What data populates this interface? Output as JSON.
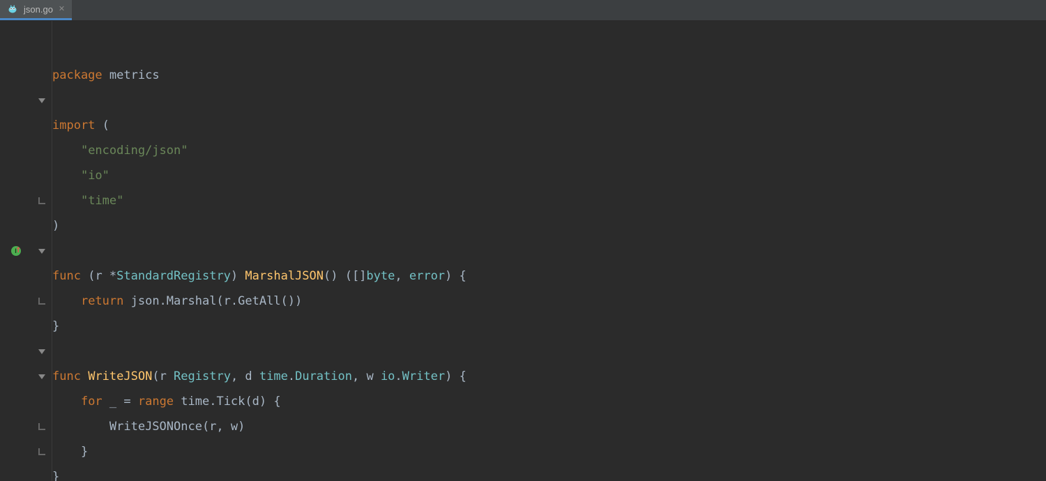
{
  "tab": {
    "filename": "json.go",
    "close_glyph": "✕"
  },
  "gutter_marker": "implements-up",
  "code": {
    "l1": {
      "kw": "package",
      "id": "metrics"
    },
    "l3": {
      "kw": "import",
      "p": "("
    },
    "l4": {
      "s": "\"encoding/json\""
    },
    "l5": {
      "s": "\"io\""
    },
    "l6": {
      "s": "\"time\""
    },
    "l7": {
      "p": ")"
    },
    "l9": {
      "kw": "func",
      "p1": "(r *",
      "t1": "StandardRegistry",
      "p2": ") ",
      "fn": "MarshalJSON",
      "p3": "() ([]",
      "t2": "byte",
      "p4": ", ",
      "t3": "error",
      "p5": ") {"
    },
    "l10": {
      "kw": "return",
      "rest": " json.Marshal(r.GetAll())"
    },
    "l11": {
      "p": "}"
    },
    "l13": {
      "kw": "func",
      "sp": " ",
      "fn": "WriteJSON",
      "p1": "(r ",
      "t1": "Registry",
      "p2": ", d ",
      "t2": "time",
      "p3": ".",
      "t3": "Duration",
      "p4": ", w ",
      "t4": "io",
      "p5": ".",
      "t5": "Writer",
      "p6": ") {"
    },
    "l14": {
      "kw": "for",
      "lhs": " _ = ",
      "kw2": "range",
      "rest": " time.Tick(d) {"
    },
    "l15": {
      "call": "WriteJSONOnce(r, w)"
    },
    "l16": {
      "p": "}"
    },
    "l17": {
      "p": "}"
    }
  }
}
